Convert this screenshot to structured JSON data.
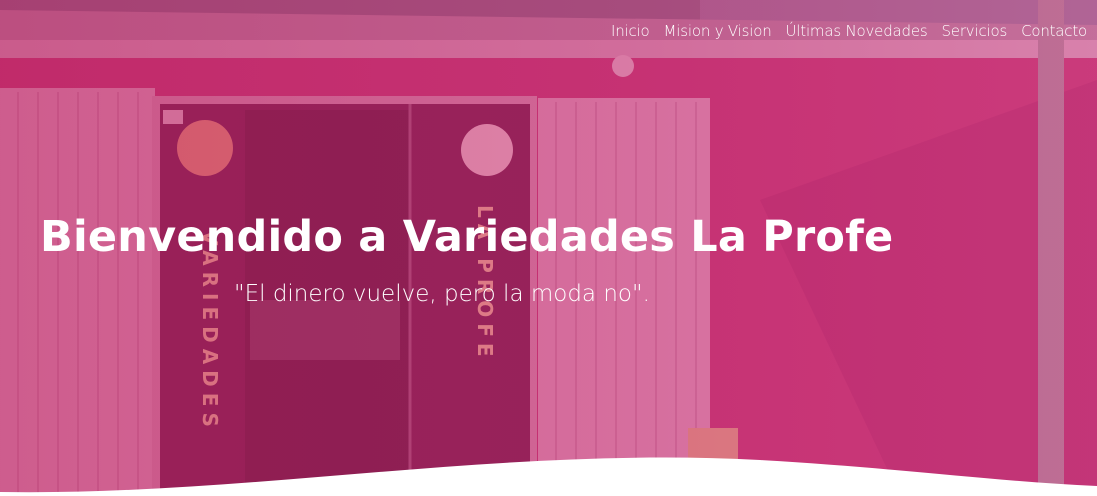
{
  "nav": {
    "items": [
      {
        "label": "Inicio"
      },
      {
        "label": "Mision y Vision"
      },
      {
        "label": "Últimas Novedades"
      },
      {
        "label": "Servicios"
      },
      {
        "label": "Contacto"
      }
    ]
  },
  "hero": {
    "title": "Bienvendido a Variedades La Profe",
    "tagline": "\"El dinero vuelve, pero la moda no\".",
    "door_letters_left": "VARIEDADES",
    "door_letters_right": "LA PROFE"
  },
  "colors": {
    "overlay": "#c2246a",
    "wall": "#c43a78",
    "text": "#ffffff"
  }
}
